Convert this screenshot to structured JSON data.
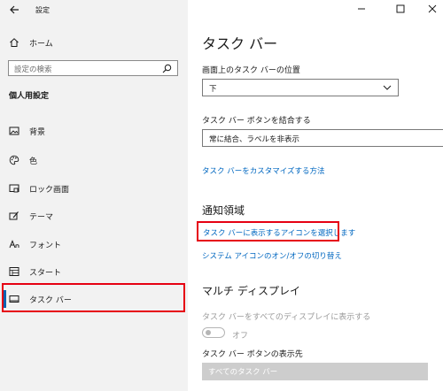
{
  "window": {
    "title": "設定",
    "back_icon": "back-arrow-icon",
    "minimize_icon": "minimize-icon",
    "maximize_icon": "maximize-icon",
    "close_icon": "close-icon"
  },
  "sidebar": {
    "home_label": "ホーム",
    "search_placeholder": "設定の検索",
    "section_title": "個人用設定",
    "items": [
      {
        "label": "背景",
        "icon": "image-icon"
      },
      {
        "label": "色",
        "icon": "palette-icon"
      },
      {
        "label": "ロック画面",
        "icon": "lock-screen-icon"
      },
      {
        "label": "テーマ",
        "icon": "theme-icon"
      },
      {
        "label": "フォント",
        "icon": "font-icon"
      },
      {
        "label": "スタート",
        "icon": "start-icon"
      },
      {
        "label": "タスク バー",
        "icon": "taskbar-icon",
        "selected": true
      }
    ]
  },
  "main": {
    "title": "タスク バー",
    "position_label": "画面上のタスク バーの位置",
    "position_value": "下",
    "combine_label": "タスク バー ボタンを結合する",
    "combine_value": "常に結合、ラベルを非表示",
    "customize_link": "タスク バーをカスタマイズする方法",
    "notification_heading": "通知領域",
    "select_icons_link": "タスク バーに表示するアイコンを選択します",
    "system_icons_link": "システム アイコンのオン/オフの切り替え",
    "multi_display_heading": "マルチ ディスプレイ",
    "show_all_displays_label": "タスク バーをすべてのディスプレイに表示する",
    "toggle_state": "オフ",
    "buttons_display_label": "タスク バー ボタンの表示先",
    "buttons_display_value": "すべてのタスク バー"
  },
  "colors": {
    "highlight": "#e60012",
    "accent": "#0063b1",
    "link": "#0067c0"
  }
}
